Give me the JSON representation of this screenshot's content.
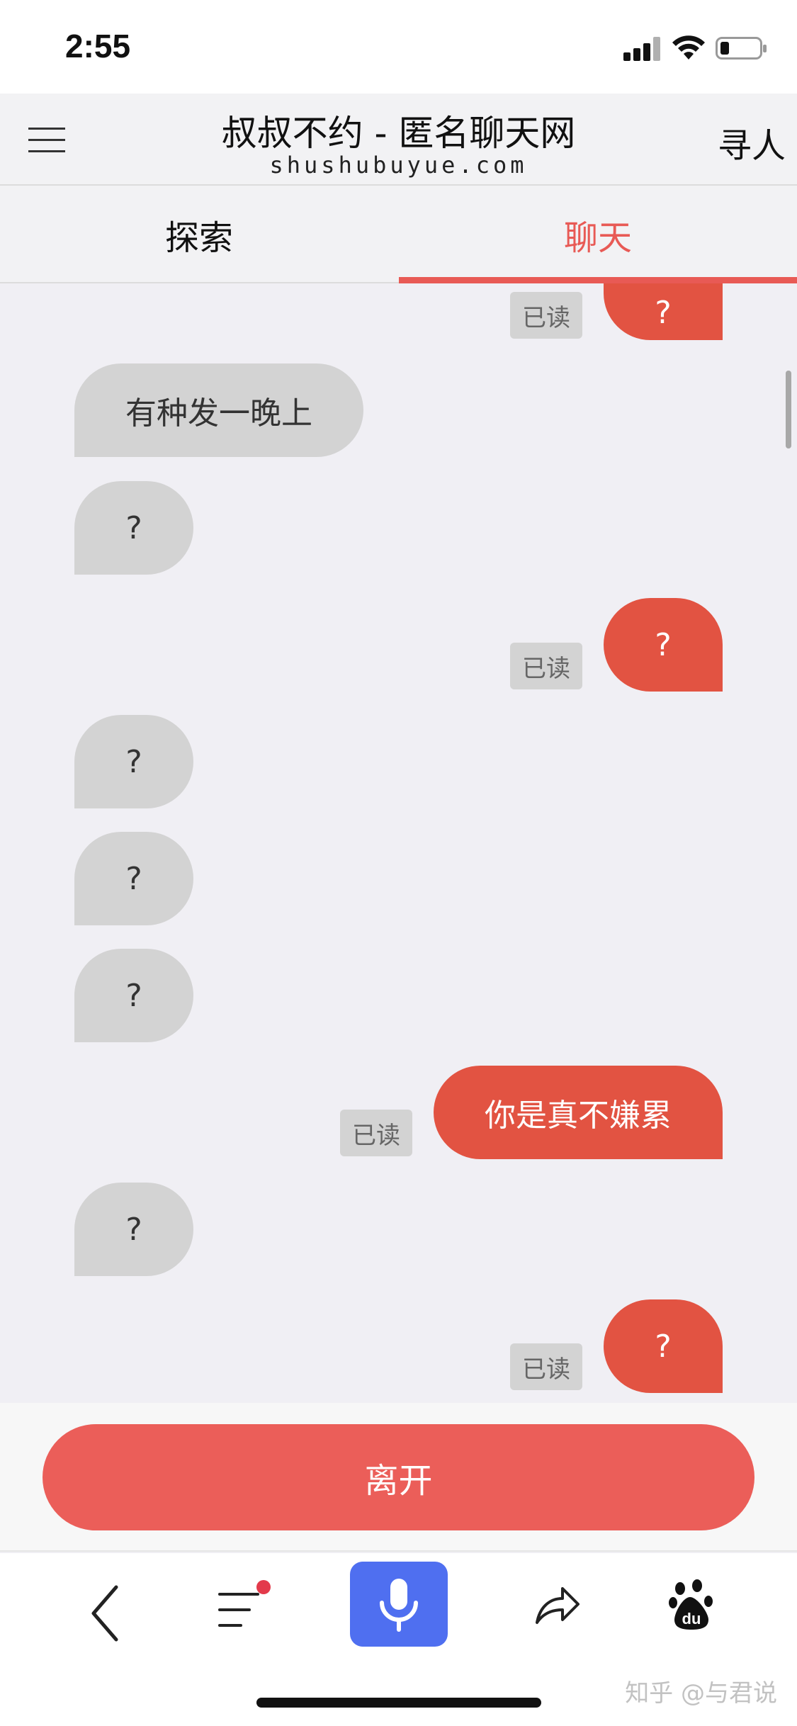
{
  "status_bar": {
    "time": "2:55"
  },
  "header": {
    "title": "叔叔不约 - 匿名聊天网",
    "subtitle": "shushubuyue.com",
    "find_label": "寻人"
  },
  "tabs": [
    {
      "label": "探索",
      "active": false
    },
    {
      "label": "聊天",
      "active": true
    }
  ],
  "messages": [
    {
      "side": "out",
      "text": "?",
      "status": "已读"
    },
    {
      "side": "in",
      "text": "有种发一晚上"
    },
    {
      "side": "in",
      "text": "?"
    },
    {
      "side": "out",
      "text": "?",
      "status": "已读"
    },
    {
      "side": "in",
      "text": "?"
    },
    {
      "side": "in",
      "text": "?"
    },
    {
      "side": "in",
      "text": "?"
    },
    {
      "side": "out",
      "text": "你是真不嫌累",
      "status": "已读"
    },
    {
      "side": "in",
      "text": "?"
    },
    {
      "side": "out",
      "text": "?",
      "status": "已读"
    }
  ],
  "leave_button": {
    "label": "离开"
  },
  "bottom_nav": {
    "icons": [
      "back-icon",
      "list-icon",
      "microphone-icon",
      "share-icon",
      "baidu-paw-icon"
    ],
    "paw_text": "du",
    "has_notification_dot": true
  },
  "watermark": "知乎 @与君说",
  "colors": {
    "accent": "#e85a55",
    "outgoing_bubble": "#e25342",
    "incoming_bubble": "#d3d3d3",
    "mic_button": "#4f6ff0",
    "leave_button": "#eb5e59"
  }
}
